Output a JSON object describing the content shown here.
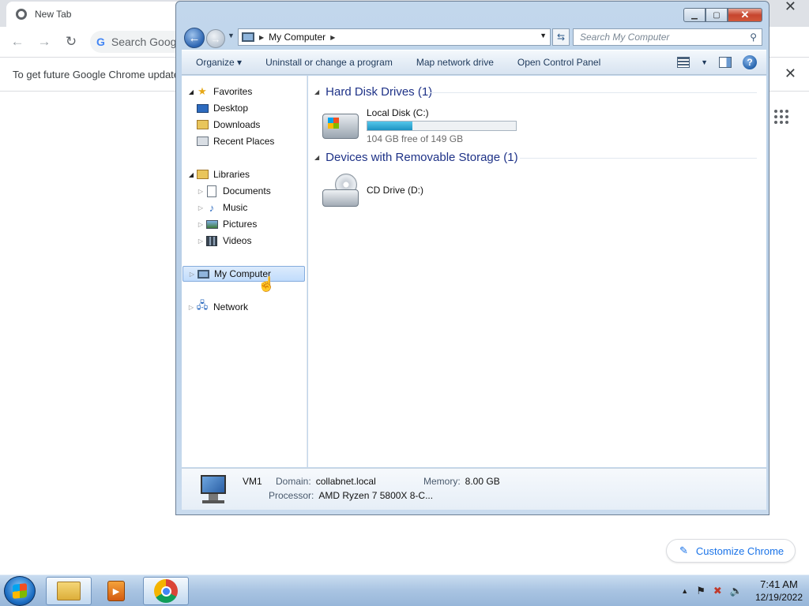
{
  "chrome": {
    "tab_title": "New Tab",
    "tab_close": "✕",
    "search_placeholder": "Search Google",
    "infobar_text": "To get future Google Chrome updates",
    "infobar_close": "✕",
    "customize_label": "Customize Chrome"
  },
  "explorer": {
    "address": "My Computer",
    "search_placeholder": "Search My Computer",
    "toolbar": {
      "organize": "Organize ▾",
      "uninstall": "Uninstall or change a program",
      "map_drive": "Map network drive",
      "control_panel": "Open Control Panel",
      "help": "?"
    },
    "nav": {
      "favorites": "Favorites",
      "desktop": "Desktop",
      "downloads": "Downloads",
      "recent": "Recent Places",
      "libraries": "Libraries",
      "documents": "Documents",
      "music": "Music",
      "pictures": "Pictures",
      "videos": "Videos",
      "computer": "My Computer",
      "network": "Network"
    },
    "groups": {
      "hdd": "Hard Disk Drives (1)",
      "removable": "Devices with Removable Storage (1)"
    },
    "drives": {
      "c_name": "Local Disk (C:)",
      "c_free": "104 GB free of 149 GB",
      "c_used_fraction": 0.302,
      "d_name": "CD Drive (D:)"
    },
    "details": {
      "name": "VM1",
      "domain_label": "Domain:",
      "domain_value": "collabnet.local",
      "memory_label": "Memory:",
      "memory_value": "8.00 GB",
      "processor_label": "Processor:",
      "processor_value": "AMD Ryzen 7 5800X 8-C..."
    }
  },
  "taskbar": {
    "time": "7:41 AM",
    "date": "12/19/2022"
  }
}
